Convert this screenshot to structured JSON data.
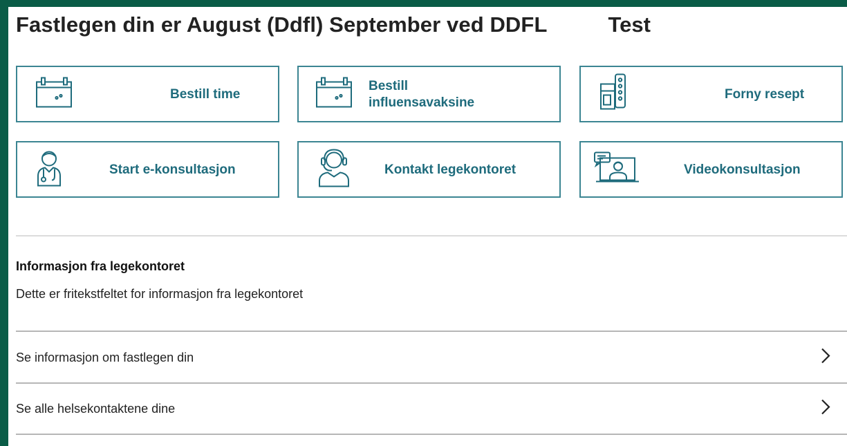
{
  "header": {
    "title": "Fastlegen din er August (Ddfl) September ved DDFL",
    "org": "Test"
  },
  "tiles": [
    {
      "label": "Bestill time",
      "icon": "calendar-icon"
    },
    {
      "label_line1": "Bestill",
      "label_line2": "influensavaksine",
      "icon": "calendar-icon"
    },
    {
      "label": "Forny resept",
      "icon": "prescription-icon"
    },
    {
      "label": "Start e-konsultasjon",
      "icon": "doctor-icon"
    },
    {
      "label": "Kontakt legekontoret",
      "icon": "headset-agent-icon"
    },
    {
      "label": "Videokonsultasjon",
      "icon": "video-call-icon"
    }
  ],
  "info": {
    "title": "Informasjon fra legekontoret",
    "text": "Dette er fritekstfeltet for informasjon fra legekontoret"
  },
  "links": [
    {
      "label": "Se informasjon om fastlegen din",
      "icon": "chevron-right-icon"
    },
    {
      "label": "Se alle helsekontaktene dine",
      "icon": "chevron-right-icon"
    }
  ],
  "colors": {
    "frame": "#0a5c47",
    "accent": "#1e6b7c",
    "tile_border": "#3b8592"
  }
}
